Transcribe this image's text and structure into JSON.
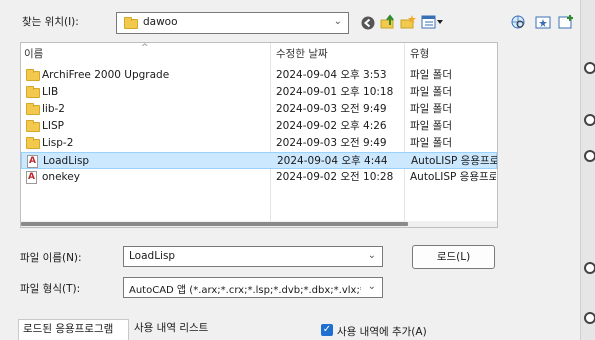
{
  "top": {
    "look_in_label": "찾는 위치(I):",
    "folder_combo_value": "dawoo",
    "icons": [
      "back-icon",
      "up-folder-icon",
      "new-folder-icon",
      "views-menu-icon",
      "search-web-icon",
      "favorites-icon",
      "add-favorite-icon"
    ]
  },
  "list": {
    "columns": {
      "name": "이름",
      "modified": "수정한 날짜",
      "type": "유형"
    },
    "rows": [
      {
        "name": "ArchiFree 2000 Upgrade",
        "modified": "2024-09-04 오후 3:53",
        "type": "파일 폴더",
        "icon": "folder-icon"
      },
      {
        "name": "LIB",
        "modified": "2024-09-01 오후 10:18",
        "type": "파일 폴더",
        "icon": "folder-icon"
      },
      {
        "name": "lib-2",
        "modified": "2024-09-03 오전 9:49",
        "type": "파일 폴더",
        "icon": "folder-icon"
      },
      {
        "name": "LISP",
        "modified": "2024-09-02 오후 4:26",
        "type": "파일 폴더",
        "icon": "folder-icon"
      },
      {
        "name": "Lisp-2",
        "modified": "2024-09-03 오전 9:49",
        "type": "파일 폴더",
        "icon": "folder-icon"
      },
      {
        "name": "LoadLisp",
        "modified": "2024-09-04 오후 4:44",
        "type": "AutoLISP 응용프로",
        "icon": "lisp-file-icon",
        "selected": true
      },
      {
        "name": "onekey",
        "modified": "2024-09-02 오전 10:28",
        "type": "AutoLISP 응용프로",
        "icon": "lisp-file-icon"
      }
    ]
  },
  "form": {
    "filename_label": "파일 이름(N):",
    "filename_value": "LoadLisp",
    "filetype_label": "파일 형식(T):",
    "filetype_value": "AutoCAD 앱 (*.arx;*.crx;*.lsp;*.dvb;*.dbx;*.vlx;*.fas",
    "load_button": "로드(L)"
  },
  "bottom": {
    "tabs": [
      "로드된 응용프로그램",
      "사용 내역 리스트"
    ],
    "history_checkbox_label": "사용 내역에 추가(A)",
    "history_checked": true
  },
  "colors": {
    "selection": "#cce8ff",
    "folder": "#f2c94c",
    "checkbox": "#1f6fd0"
  }
}
